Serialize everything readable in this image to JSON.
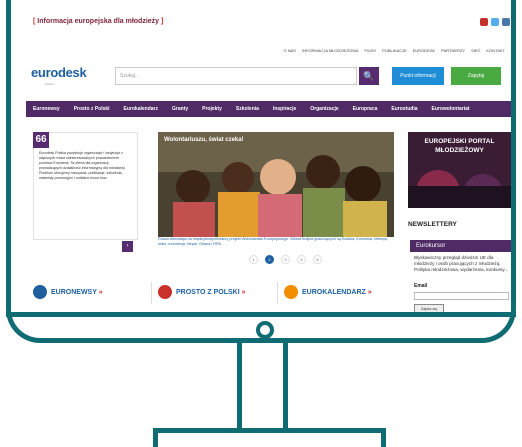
{
  "topbar": {
    "label": "Informacja europejska dla młodzieży",
    "bracket_open": "[",
    "bracket_close": "]"
  },
  "toplinks": [
    "O NAS",
    "INFORMACJA MŁODZIEŻOWA",
    "FILMY",
    "PUBLIKACJE",
    "EURODESK",
    "PARTNERZY",
    "SIEĆ",
    "KONTAKT"
  ],
  "header": {
    "logo_main": "euro",
    "logo_accent": "desk",
    "logo_sub": "polska",
    "search_placeholder": "Szukaj...",
    "search_icon": "magnifier",
    "punkt_label": "Punkt informacji",
    "zapytaj_label": "Zapytaj"
  },
  "nav": [
    "Euronewsy",
    "Prosto z Polski",
    "Eurokalendarz",
    "Granty",
    "Projekty",
    "Szkolenia",
    "Inspiracje",
    "Organizacje",
    "Europraca",
    "Eurostudia",
    "Eurowolontariat"
  ],
  "quote": {
    "mark": "66",
    "text": "Eurodesk Polska pozyskuje organizacje i instytucje z większych miast zainteresowanych prowadzeniem punktów Eurodesk. Ta oferta dla organizacji prowadzących działalność informacyjną dla młodzieży. Punktom oferujemy narzędzia, publikacje, szkolenia, materiały promocyjne i unikalne know-how.",
    "next": "›"
  },
  "slider": {
    "title": "Wolontariuszu, świat czeka!",
    "caption": "Rusza rekrutacja na międzykontynentalny projekt Wolontariatu Europejskiego. Wśród krajów goszczących są Boliwia, Kolumbia, Meksyk, Indie, Indonezja, Nepal, Ghana i RPA.",
    "pages": [
      "1",
      "2",
      "3",
      "4",
      "5"
    ],
    "active_page": "2"
  },
  "portal": {
    "text": "EUROPEJSKI PORTAL MŁODZIEŻOWY"
  },
  "newsletter": {
    "heading": "NEWSLETTERY"
  },
  "eurokursor": {
    "heading": "Eurokursor",
    "text": "Błyskawiczny przegląd dziedzin UE dla młodzieży i osób pracujących z młodzieżą. Polityka młodzieżowa, wydarzenia, konkursy...",
    "email_label": "Email",
    "signup": "Zapisz się"
  },
  "sections": [
    {
      "label": "EURONEWSY",
      "arrow": "»",
      "color": "#1d5f9f",
      "icon": "globe-icon"
    },
    {
      "label": "PROSTO Z POLSKI",
      "arrow": "»",
      "color": "#c9302c",
      "icon": "pin-icon"
    },
    {
      "label": "EUROKALENDARZ",
      "arrow": "»",
      "color": "#f28c00",
      "icon": "calendar-icon"
    }
  ]
}
